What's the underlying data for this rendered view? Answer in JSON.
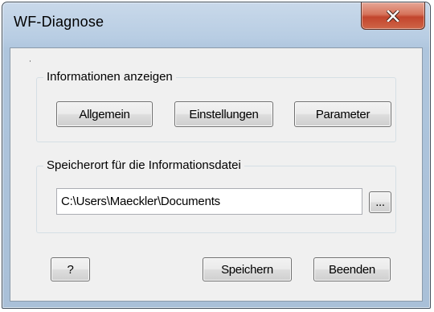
{
  "window": {
    "title": "WF-Diagnose",
    "close_icon": "close-icon"
  },
  "info_group": {
    "legend": "Informationen anzeigen",
    "buttons": {
      "general": "Allgemein",
      "settings": "Einstellungen",
      "parameters": "Parameter"
    }
  },
  "path_group": {
    "legend": "Speicherort für die Informationsdatei",
    "path_value": "C:\\Users\\Maeckler\\Documents",
    "browse_label": "..."
  },
  "footer": {
    "help_label": "?",
    "save_label": "Speichern",
    "exit_label": "Beenden"
  },
  "colors": {
    "close_button": "#c8543a",
    "dialog_background": "#f0f0f0",
    "frame": "#b8cde3"
  }
}
